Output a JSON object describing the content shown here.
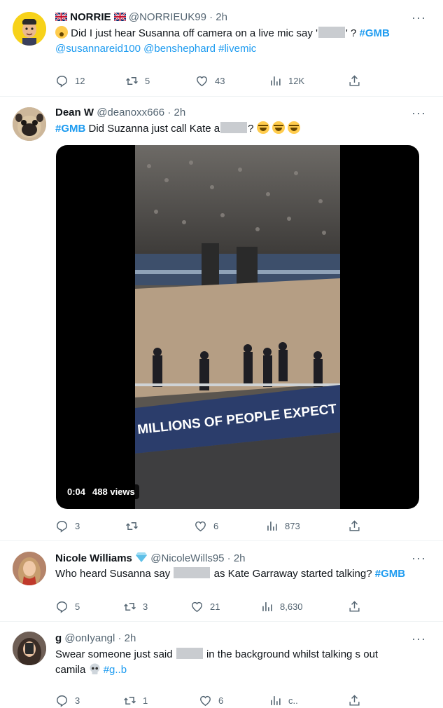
{
  "icons": [
    "flag-uk-icon",
    "reply-icon",
    "retweet-icon",
    "like-icon",
    "views-icon",
    "share-icon",
    "verified-diamond-icon",
    "skull-icon",
    "face-with-tears-of-joy-icon",
    "astonished-face-icon",
    "more-icon"
  ],
  "colors": {
    "link": "#1d9bf0",
    "muted": "#536471",
    "text": "#0f1419",
    "redaction": "#c9ccd0"
  },
  "tweets": [
    {
      "name": "NORRIE",
      "handle": "@NORRIEUK99",
      "time": "· 2h",
      "text_1": "Did I just hear Susanna off camera on a live mic say '",
      "text_2": "' ?",
      "hashtag": "#GMB",
      "line_2": "@susannareid100 @benshephard #livemic",
      "replies": "12",
      "retweets": "5",
      "likes": "43",
      "views": "12K"
    },
    {
      "name": "Dean W",
      "handle": "@deanoxx666",
      "time": "· 2h",
      "hashtag": "#GMB",
      "text_1": "Did Suzanna just call Kate a",
      "text_2": "?",
      "video_time": "0:04",
      "video_views": "488 views",
      "video_banner": "MILLIONS OF PEOPLE EXPECT",
      "replies": "3",
      "retweets": "",
      "likes": "6",
      "views": "873"
    },
    {
      "name": "Nicole Williams",
      "handle": "@NicoleWills95",
      "time": "· 2h",
      "text_1": "Who heard Susanna say",
      "text_2": "as Kate Garraway started talking?",
      "hashtag": "#GMB",
      "replies": "5",
      "retweets": "3",
      "likes": "21",
      "views": "8,630"
    },
    {
      "name": "g",
      "handle": "@onIyangl",
      "time": "· 2h",
      "text_1": "Swear someone just said",
      "text_2": "in the background whilst talking s out",
      "line_2": "camila",
      "hashtag": "#g..b",
      "replies": "3",
      "retweets": "1",
      "likes": "6",
      "views": "c.."
    }
  ]
}
